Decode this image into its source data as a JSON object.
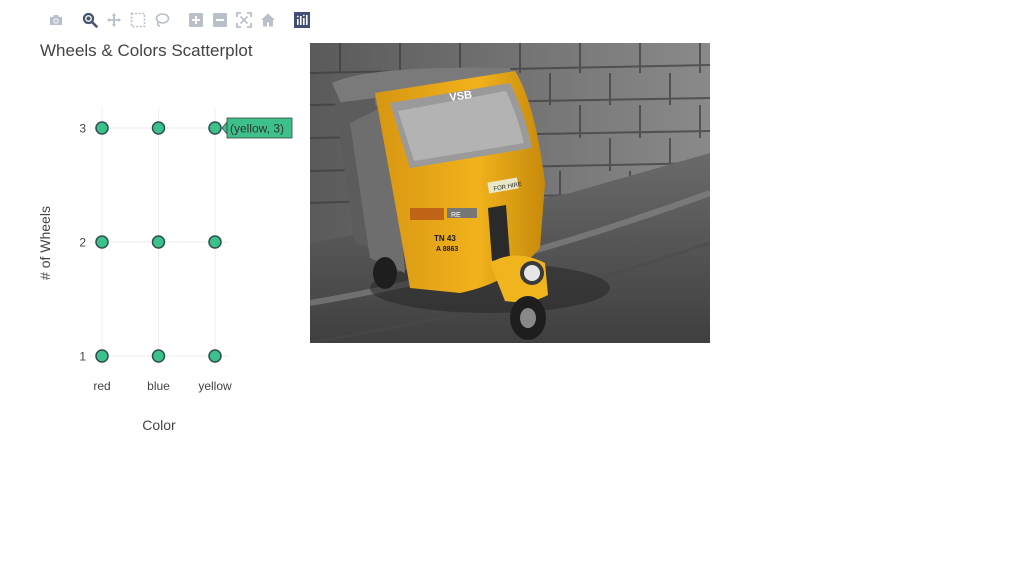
{
  "modebar": {
    "buttons": [
      {
        "name": "camera-icon",
        "group": 0
      },
      {
        "name": "zoom-icon",
        "group": 1,
        "active": true
      },
      {
        "name": "pan-icon",
        "group": 1
      },
      {
        "name": "box-select-icon",
        "group": 1
      },
      {
        "name": "lasso-select-icon",
        "group": 1
      },
      {
        "name": "zoom-in-icon",
        "group": 2
      },
      {
        "name": "zoom-out-icon",
        "group": 2
      },
      {
        "name": "autoscale-icon",
        "group": 2
      },
      {
        "name": "reset-axes-icon",
        "group": 2
      },
      {
        "name": "plotly-logo-icon",
        "group": 3
      }
    ],
    "colors": {
      "icon": "#b9c0c9",
      "active": "#44546a",
      "logo_bg": "#3f4f75"
    }
  },
  "chart_data": {
    "type": "scatter",
    "title": "Wheels & Colors Scatterplot",
    "xlabel": "Color",
    "ylabel": "# of Wheels",
    "categories": [
      "red",
      "blue",
      "yellow"
    ],
    "y_ticks": [
      "1",
      "2",
      "3"
    ],
    "ylim": [
      1,
      3
    ],
    "points": [
      {
        "x": "red",
        "y": 1
      },
      {
        "x": "red",
        "y": 2
      },
      {
        "x": "red",
        "y": 3
      },
      {
        "x": "blue",
        "y": 1
      },
      {
        "x": "blue",
        "y": 2
      },
      {
        "x": "blue",
        "y": 3
      },
      {
        "x": "yellow",
        "y": 1
      },
      {
        "x": "yellow",
        "y": 2
      },
      {
        "x": "yellow",
        "y": 3
      }
    ],
    "marker_color": "#3cc18a",
    "marker_edge": "#2f4f4f",
    "grid": true,
    "hover": {
      "x": "yellow",
      "y": 3,
      "text": "(yellow, 3)"
    }
  },
  "image": {
    "plate_line1": "TN 43",
    "plate_line2": "A 8863",
    "windshield_text": "VSB",
    "front_badge": "FOR HIRE",
    "body_badge": "RE"
  }
}
